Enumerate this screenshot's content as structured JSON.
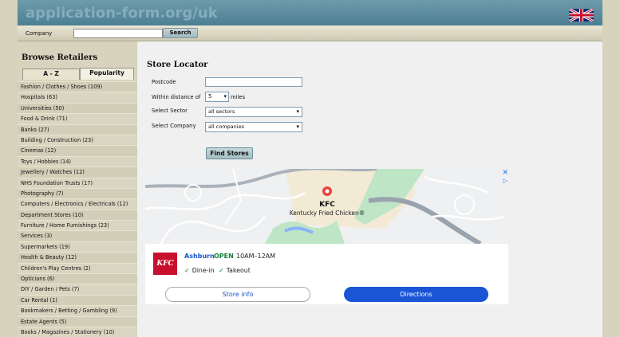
{
  "header": {
    "site_title": "application-form.org/uk",
    "flag_icon": "uk-flag-icon"
  },
  "search": {
    "label": "Company",
    "value": "",
    "button": "Search"
  },
  "sidebar": {
    "heading": "Browse Retailers",
    "tabs": [
      "A - Z",
      "Popularity"
    ],
    "active_tab": "Popularity",
    "categories": [
      "Fashion / Clothes / Shoes (109)",
      "Hospitals (63)",
      "Universities (50)",
      "Food & Drink (71)",
      "Banks (27)",
      "Building / Construction (23)",
      "Cinemas (12)",
      "Toys / Hobbies (14)",
      "Jewellery / Watches (12)",
      "NHS Foundation Trusts (17)",
      "Photography (7)",
      "Computers / Electronics / Electricals (12)",
      "Department Stores (10)",
      "Furniture / Home Furnishings (23)",
      "Services (3)",
      "Supermarkets (19)",
      "Health & Beauty (12)",
      "Children's Play Centres (2)",
      "Opticians (6)",
      "DIY / Garden / Pets (7)",
      "Car Rental (1)",
      "Bookmakers / Betting / Gambling (9)",
      "Estate Agents (5)",
      "Books / Magazines / Stationery (10)"
    ]
  },
  "locator": {
    "title": "Store Locator",
    "postcode_label": "Postcode",
    "postcode_value": "",
    "distance_label": "Within distance of",
    "distance_value": "5",
    "distance_unit": "miles",
    "sector_label": "Select Sector",
    "sector_value": "all sectors",
    "company_label": "Select Company",
    "company_value": "all companies",
    "find_button": "Find Stores"
  },
  "ad": {
    "close_icon": "close-icon",
    "adchoices_icon": "adchoices-icon",
    "map_pin_title": "KFC",
    "map_pin_subtitle": "Kentucky Fried Chicken®",
    "logo_text": "KFC",
    "location": "Ashburn",
    "status": "OPEN",
    "hours": "10AM–12AM",
    "features": [
      "Dine-in",
      "Takeout"
    ],
    "store_info_button": "Store info",
    "directions_button": "Directions",
    "colors": {
      "accent": "#1a55d6",
      "kfc_red": "#c8102e",
      "open_green": "#188038"
    }
  }
}
